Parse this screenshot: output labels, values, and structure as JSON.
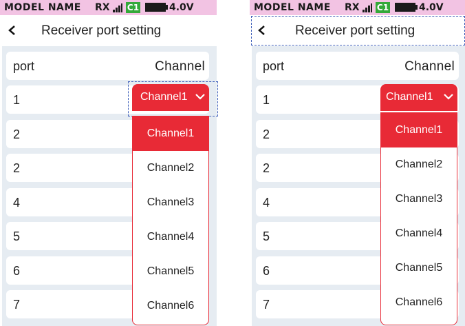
{
  "statusbar": {
    "model": "MODEL NAME",
    "rx": "RX",
    "model_slot": "C1",
    "voltage": "4.0V"
  },
  "header": {
    "title": "Receiver port setting"
  },
  "table": {
    "header_port": "port",
    "header_channel": "Channel",
    "ports": [
      "1",
      "2",
      "2",
      "4",
      "5",
      "6",
      "7"
    ]
  },
  "select": {
    "value": "Channel1"
  },
  "options": [
    "Channel1",
    "Channel2",
    "Channel3",
    "Channel4",
    "Channel5",
    "Channel6"
  ],
  "colors": {
    "accent": "#e82a36",
    "statusbar": "#f2c3e3",
    "panel": "#e6ecf2",
    "model_slot": "#35a93a",
    "focus": "#3a5bb8"
  }
}
